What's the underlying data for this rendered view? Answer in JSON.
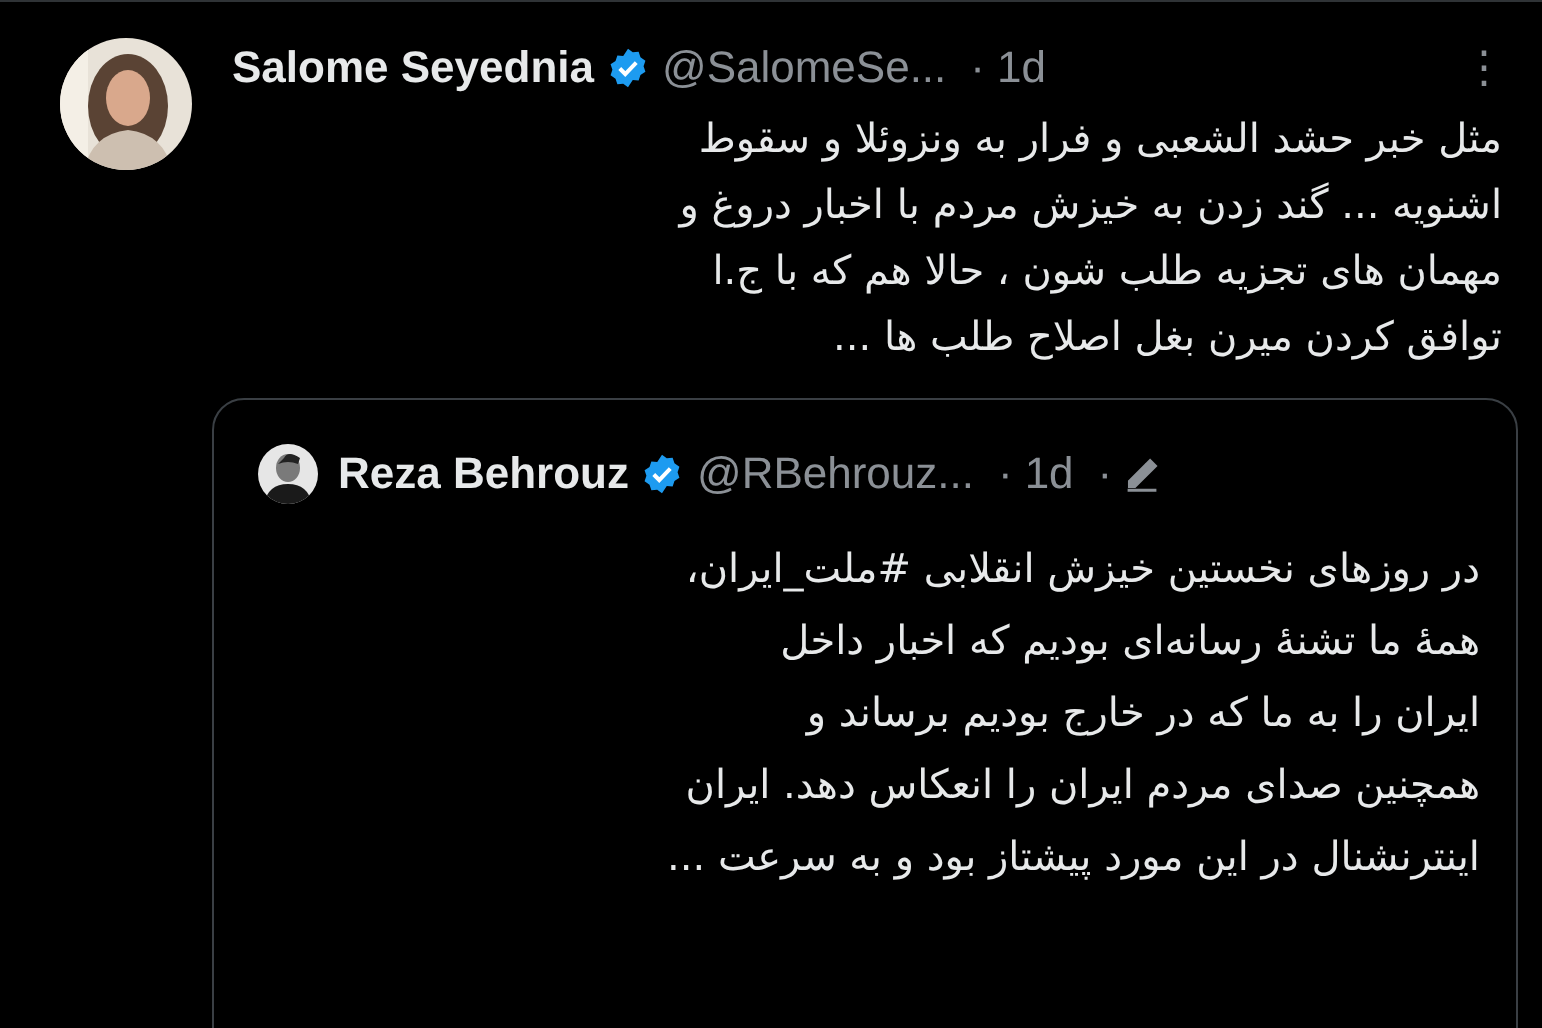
{
  "tweet": {
    "name": "Salome Seyednia",
    "verified": true,
    "handle": "@SalomeSe...",
    "separator": "·",
    "time": "1d",
    "more": "⋮",
    "text": "مثل خبر حشد الشعبی و فرار به ونزوئلا و سقوط\nاشنویه ... گند زدن به خیزش مردم با اخبار دروغ و\nمهمان های تجزیه طلب شون ، حالا هم که با ج.ا\nتوافق کردن میرن بغل اصلاح طلب ها ...",
    "quote": {
      "name": "Reza Behrouz",
      "verified": true,
      "handle": "@RBehrouz...",
      "separator": "·",
      "time": "1d",
      "separator_2": "·",
      "edited": true,
      "text": "در روزهای نخستین خیزش انقلابی #ملت_ایران،\nهمهٔ ما تشنهٔ رسانه‌ای بودیم که اخبار داخل\nایران را به ما که در خارج بودیم برساند و\nهمچنین صدای مردم ایران را انعکاس دهد. ایران\nاینترنشنال در این مورد پیشتاز بود و به سرعت ..."
    }
  }
}
